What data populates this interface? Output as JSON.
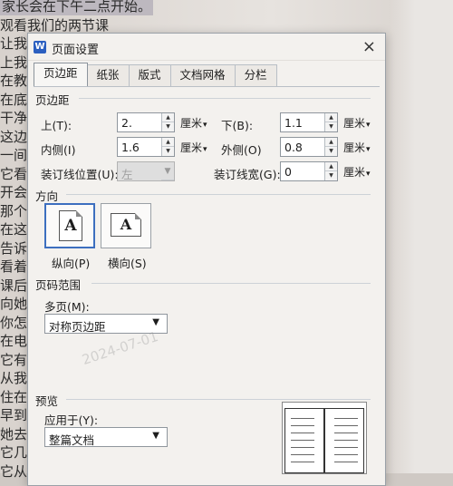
{
  "background": {
    "lines": [
      "家长会在下午二点开始。",
      "观看我们的两节课",
      "让我",
      "上我",
      "在教",
      "在底",
      "干净",
      "这边",
      "一间",
      "它看",
      "开会",
      "那个",
      "在这",
      "告诉",
      "看着",
      "课后",
      "向她",
      "你怎",
      "在电",
      "它有",
      "从我",
      "住在",
      "早到",
      "她去",
      "它几",
      "它从"
    ],
    "watermark": "2024-07-01"
  },
  "dialog": {
    "app_icon": "W",
    "title": "页面设置",
    "close_icon": "×",
    "tabs": [
      "页边距",
      "纸张",
      "版式",
      "文档网格",
      "分栏"
    ],
    "margins_section": "页边距",
    "top_label": "上(T):",
    "top_value": "2.",
    "bottom_label": "下(B):",
    "bottom_value": "1.1",
    "inside_label": "内侧(I)",
    "inside_value": "1.6",
    "outside_label": "外侧(O)",
    "outside_value": "0.8",
    "gutter_pos_label": "装订线位置(U):",
    "gutter_pos_value": "左",
    "gutter_width_label": "装订线宽(G):",
    "gutter_width_value": "0",
    "unit": "厘米",
    "orientation_section": "方向",
    "portrait_label": "纵向(P)",
    "landscape_label": "横向(S)",
    "orientation_glyph": "A",
    "pages_section": "页码范围",
    "multiple_pages_label": "多页(M):",
    "multiple_pages_value": "对称页边距",
    "preview_section": "预览",
    "apply_to_label": "应用于(Y):",
    "apply_to_value": "整篇文档"
  }
}
